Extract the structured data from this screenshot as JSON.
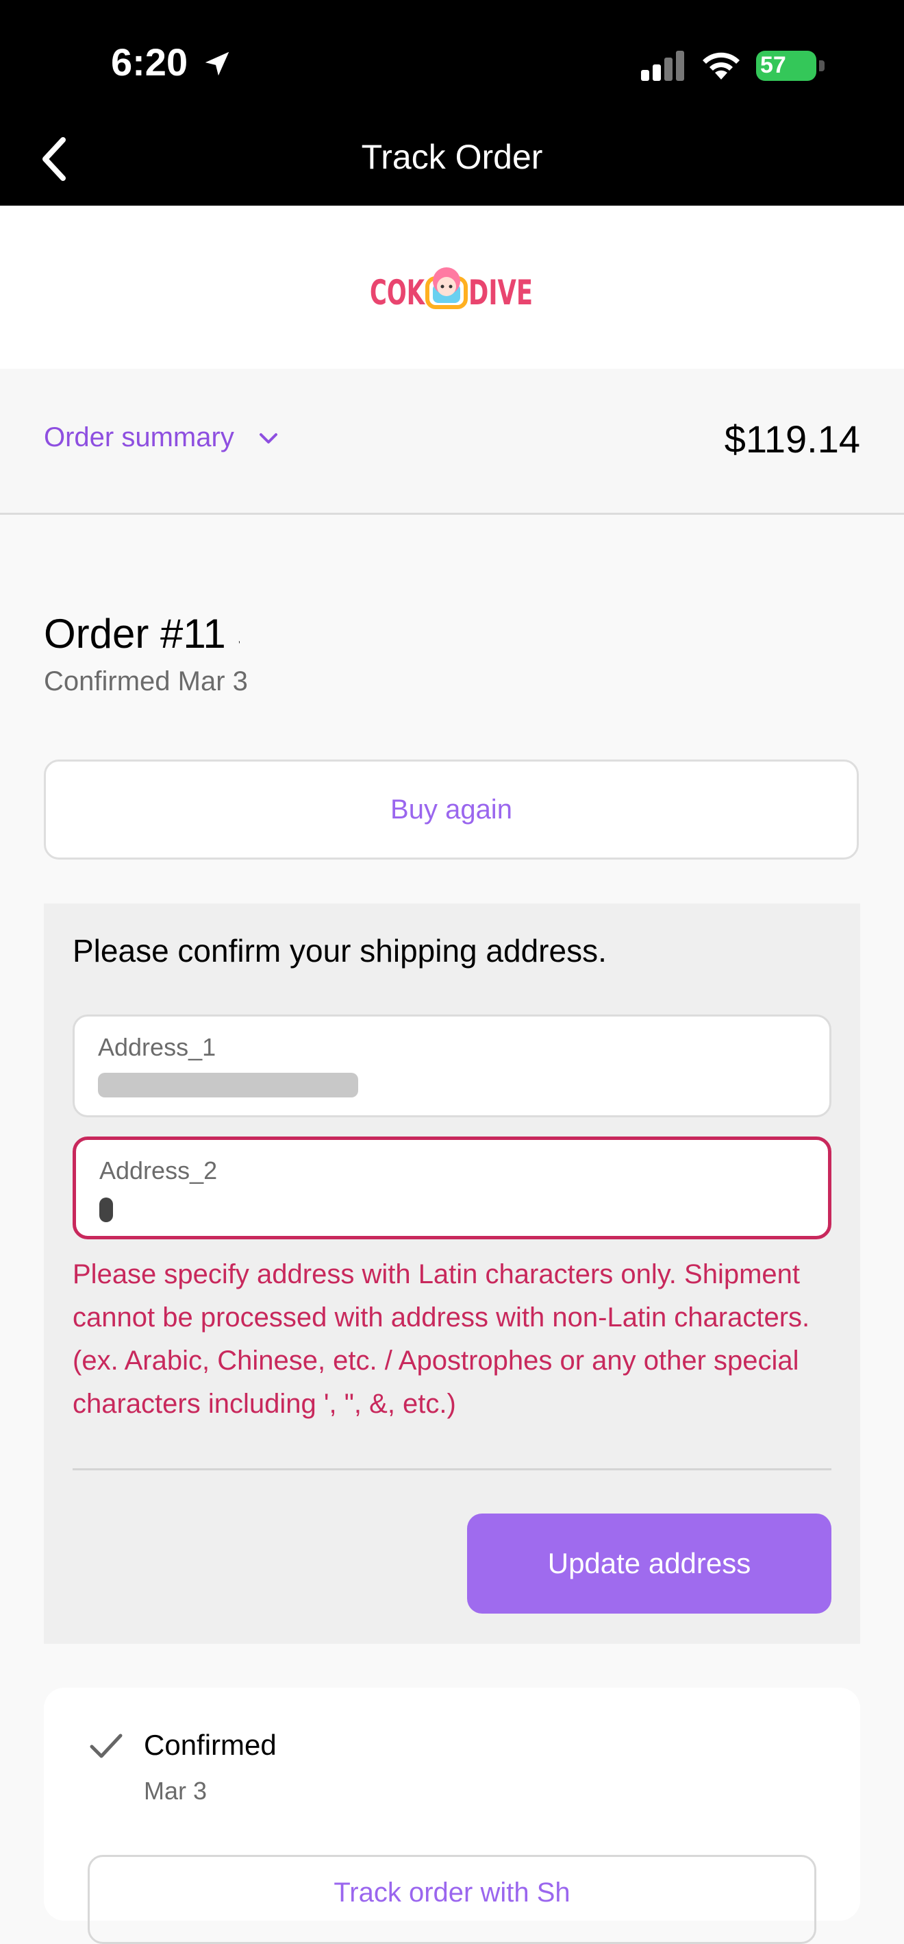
{
  "status_bar": {
    "time": "6:20",
    "battery": "57"
  },
  "nav": {
    "title": "Track Order"
  },
  "brand": {
    "logo_text": "COKODIVE"
  },
  "summary": {
    "toggle_label": "Order summary",
    "total": "$119.14"
  },
  "order": {
    "title": "Order #11          5",
    "confirmed": "Confirmed Mar 3"
  },
  "buy_again_label": "Buy again",
  "address_confirm": {
    "title": "Please confirm your shipping address.",
    "field1_label": "Address_1",
    "field2_label": "Address_2",
    "error": "Please specify address with Latin characters only. Shipment cannot be processed with address with non-Latin characters. (ex. Arabic, Chinese, etc. / Apostrophes or any other special characters including ', \", &, etc.)",
    "update_label": "Update address"
  },
  "timeline": {
    "status": "Confirmed",
    "date": "Mar 3",
    "track_label": "Track order with Sh"
  },
  "colors": {
    "accent": "#9f6bee",
    "error": "#c8285c",
    "battery": "#34c759"
  }
}
